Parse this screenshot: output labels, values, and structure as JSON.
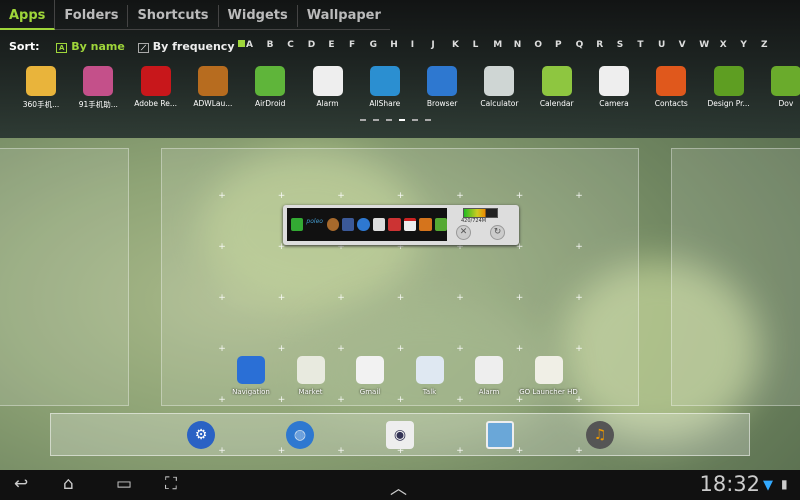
{
  "tabs": [
    "Apps",
    "Folders",
    "Shortcuts",
    "Widgets",
    "Wallpaper"
  ],
  "sort": {
    "label": "Sort:",
    "by_name": "By name",
    "by_frequency": "By frequency"
  },
  "letters": [
    "A",
    "B",
    "C",
    "D",
    "E",
    "F",
    "G",
    "H",
    "I",
    "J",
    "K",
    "L",
    "M",
    "N",
    "O",
    "P",
    "Q",
    "R",
    "S",
    "T",
    "U",
    "V",
    "W",
    "X",
    "Y",
    "Z"
  ],
  "apps": [
    {
      "label": "360手机...",
      "icon": "phone-icon",
      "color": "#e9b43b"
    },
    {
      "label": "91手机助...",
      "icon": "assistant-icon",
      "color": "#c4508a"
    },
    {
      "label": "Adobe Re...",
      "icon": "adobe-reader-icon",
      "color": "#c8171b"
    },
    {
      "label": "ADWLau...",
      "icon": "adw-launcher-icon",
      "color": "#b76c1f"
    },
    {
      "label": "AirDroid",
      "icon": "paper-plane-icon",
      "color": "#5fb53a"
    },
    {
      "label": "Alarm",
      "icon": "clock-icon",
      "color": "#eeeeee"
    },
    {
      "label": "AllShare",
      "icon": "allshare-icon",
      "color": "#2b8fd1"
    },
    {
      "label": "Browser",
      "icon": "globe-icon",
      "color": "#2e78d0"
    },
    {
      "label": "Calculator",
      "icon": "calculator-icon",
      "color": "#cfd6d4"
    },
    {
      "label": "Calendar",
      "icon": "calendar-icon",
      "color": "#8ec640"
    },
    {
      "label": "Camera",
      "icon": "camera-icon",
      "color": "#eeeeee"
    },
    {
      "label": "Contacts",
      "icon": "contacts-icon",
      "color": "#e0581c"
    },
    {
      "label": "Design Pr...",
      "icon": "design-icon",
      "color": "#5e9e22"
    },
    {
      "label": "Dov",
      "icon": "download-icon",
      "color": "#6aab2c"
    }
  ],
  "widget": {
    "memory": "420/724M",
    "memory_used_fraction": 0.65
  },
  "homescreen": [
    {
      "label": "Navigation",
      "icon": "navigation-icon",
      "color": "#2a6fd6"
    },
    {
      "label": "Market",
      "icon": "market-icon",
      "color": "#e8eadf"
    },
    {
      "label": "Gmail",
      "icon": "gmail-icon",
      "color": "#f2f2f2"
    },
    {
      "label": "Talk",
      "icon": "talk-icon",
      "color": "#dfe8f2"
    },
    {
      "label": "Alarm",
      "icon": "clock-icon",
      "color": "#eeeeee"
    },
    {
      "label": "GO Launcher HD",
      "icon": "go-launcher-icon",
      "color": "#f0efe6"
    }
  ],
  "dock": [
    "settings-icon",
    "globe-icon",
    "camera-icon",
    "gallery-icon",
    "music-icon"
  ],
  "status": {
    "time": "18:32"
  },
  "colors": {
    "accent": "#9fd63a"
  }
}
